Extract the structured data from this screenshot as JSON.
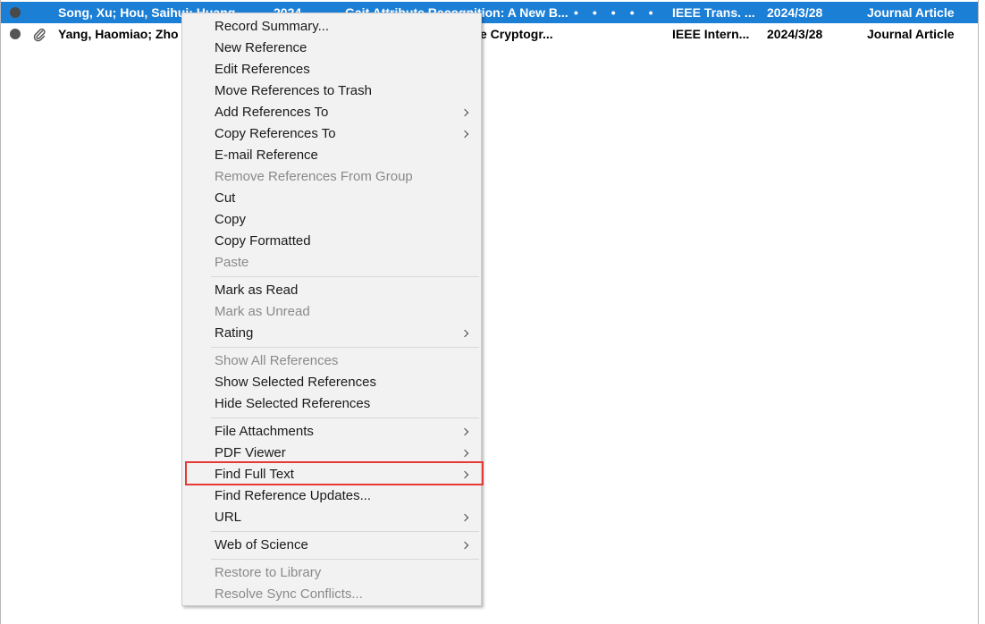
{
  "references": [
    {
      "author": "Song, Xu; Hou, Saihui; Huang...",
      "year": "2024",
      "title": "Gait Attribute Recognition: A New B...",
      "journal": "IEEE Trans. ...",
      "date": "2024/3/28",
      "type": "Journal Article",
      "selected": true,
      "has_attachment": false
    },
    {
      "author": "Yang, Haomiao; Zho",
      "year": "",
      "title": "e Cryptogr...",
      "journal": "IEEE Intern...",
      "date": "2024/3/28",
      "type": "Journal Article",
      "selected": false,
      "has_attachment": true
    }
  ],
  "context_menu": {
    "items": [
      {
        "label": "Record Summary...",
        "disabled": false,
        "submenu": false
      },
      {
        "label": "New Reference",
        "disabled": false,
        "submenu": false
      },
      {
        "label": "Edit References",
        "disabled": false,
        "submenu": false
      },
      {
        "label": "Move References to Trash",
        "disabled": false,
        "submenu": false
      },
      {
        "label": "Add References To",
        "disabled": false,
        "submenu": true
      },
      {
        "label": "Copy References To",
        "disabled": false,
        "submenu": true
      },
      {
        "label": "E-mail Reference",
        "disabled": false,
        "submenu": false
      },
      {
        "label": "Remove References From Group",
        "disabled": true,
        "submenu": false
      },
      {
        "label": "Cut",
        "disabled": false,
        "submenu": false
      },
      {
        "label": "Copy",
        "disabled": false,
        "submenu": false
      },
      {
        "label": "Copy Formatted",
        "disabled": false,
        "submenu": false
      },
      {
        "label": "Paste",
        "disabled": true,
        "submenu": false
      },
      {
        "label": "Mark as Read",
        "disabled": false,
        "submenu": false
      },
      {
        "label": "Mark as Unread",
        "disabled": true,
        "submenu": false
      },
      {
        "label": "Rating",
        "disabled": false,
        "submenu": true
      },
      {
        "label": "Show All References",
        "disabled": true,
        "submenu": false
      },
      {
        "label": "Show Selected References",
        "disabled": false,
        "submenu": false
      },
      {
        "label": "Hide Selected References",
        "disabled": false,
        "submenu": false
      },
      {
        "label": "File Attachments",
        "disabled": false,
        "submenu": true
      },
      {
        "label": "PDF Viewer",
        "disabled": false,
        "submenu": true
      },
      {
        "label": "Find Full Text",
        "disabled": false,
        "submenu": true,
        "highlighted": true
      },
      {
        "label": "Find Reference Updates...",
        "disabled": false,
        "submenu": false
      },
      {
        "label": "URL",
        "disabled": false,
        "submenu": true
      },
      {
        "label": "Web of Science",
        "disabled": false,
        "submenu": true
      },
      {
        "label": "Restore to Library",
        "disabled": true,
        "submenu": false
      },
      {
        "label": "Resolve Sync Conflicts...",
        "disabled": true,
        "submenu": false
      }
    ]
  },
  "colors": {
    "selection": "#1c7fd6",
    "highlight_box": "#e53935",
    "menu_bg": "#f2f2f2"
  }
}
